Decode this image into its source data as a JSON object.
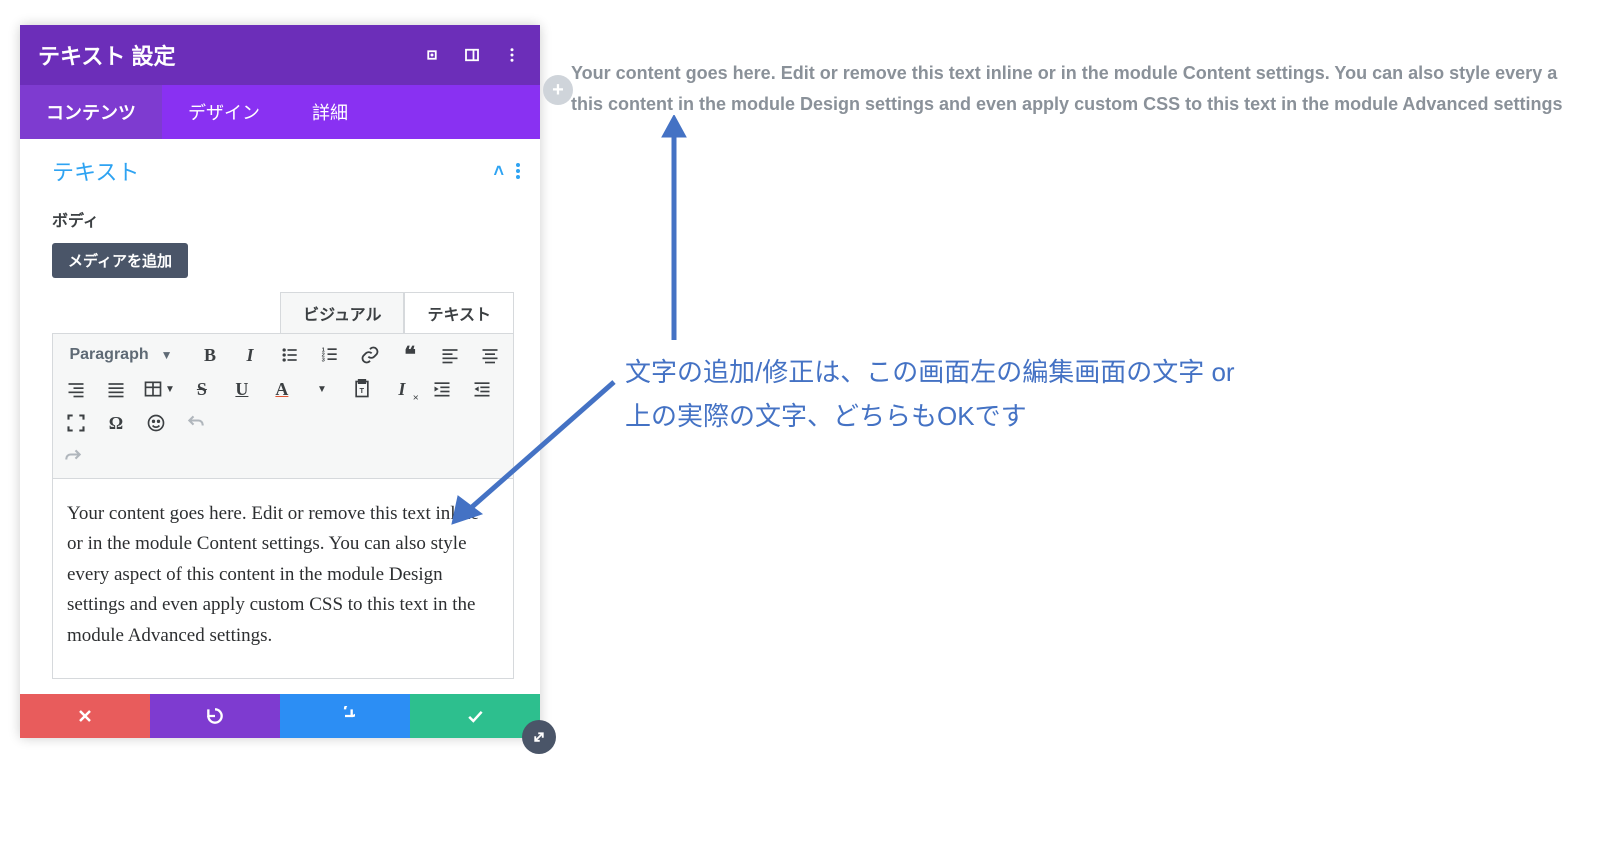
{
  "panel": {
    "title": "テキスト 設定",
    "tabs": [
      "コンテンツ",
      "デザイン",
      "詳細"
    ],
    "active_tab_index": 0,
    "accordion_title": "テキスト",
    "body_label": "ボディ",
    "add_media_label": "メディアを追加",
    "editor_tabs": {
      "visual": "ビジュアル",
      "text": "テキスト"
    },
    "format_select": "Paragraph"
  },
  "editor": {
    "content": "Your content goes here. Edit or remove this text inline or in the module Content settings. You can also style every aspect of this content in the module Design settings and even apply custom CSS to this text in the module Advanced settings."
  },
  "preview": {
    "line1": "Your content goes here. Edit or remove this text inline or in the module Content settings. You can also style every a",
    "line2": "this content in the module Design settings and even apply custom CSS to this text in the module Advanced settings"
  },
  "annotation": {
    "line1": "文字の追加/修正は、この画面左の編集画面の文字 or",
    "line2": "上の実際の文字、どちらもOKです"
  },
  "icons": {
    "expand": "expand-icon",
    "drawer": "drawer-icon",
    "more": "more-icon"
  },
  "colors": {
    "header": "#6c2eb9",
    "tabbar": "#8931f2",
    "active_tab": "#7e3bd0",
    "link_blue": "#2ea3f2",
    "footer_red": "#e85c5c",
    "footer_purple": "#7e3bd0",
    "footer_blue": "#2c8ef4",
    "footer_green": "#2dbf8e",
    "annotation_blue": "#4472c4"
  }
}
